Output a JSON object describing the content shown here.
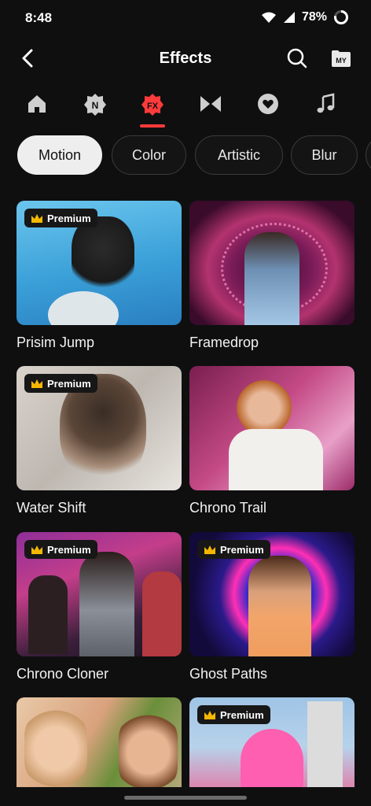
{
  "status": {
    "time": "8:48",
    "battery": "78%"
  },
  "header": {
    "title": "Effects",
    "my_label": "MY"
  },
  "tabs": [
    {
      "name": "home-icon"
    },
    {
      "name": "new-badge-icon",
      "glyph": "N"
    },
    {
      "name": "fx-icon",
      "glyph": "FX",
      "active": true
    },
    {
      "name": "transition-icon"
    },
    {
      "name": "favorite-heart-icon"
    },
    {
      "name": "music-note-icon"
    }
  ],
  "chips": [
    "Motion",
    "Color",
    "Artistic",
    "Blur"
  ],
  "premium_label": "Premium",
  "effects": [
    {
      "name": "Prisim Jump",
      "premium": true
    },
    {
      "name": "Framedrop",
      "premium": false
    },
    {
      "name": "Water Shift",
      "premium": true
    },
    {
      "name": "Chrono Trail",
      "premium": false
    },
    {
      "name": "Chrono Cloner",
      "premium": true
    },
    {
      "name": "Ghost Paths",
      "premium": true
    },
    {
      "name": "",
      "premium": false
    },
    {
      "name": "",
      "premium": true
    }
  ],
  "colors": {
    "accent": "#ff3b3b",
    "background": "#0f0f10",
    "premium_crown": "#f5b800"
  }
}
